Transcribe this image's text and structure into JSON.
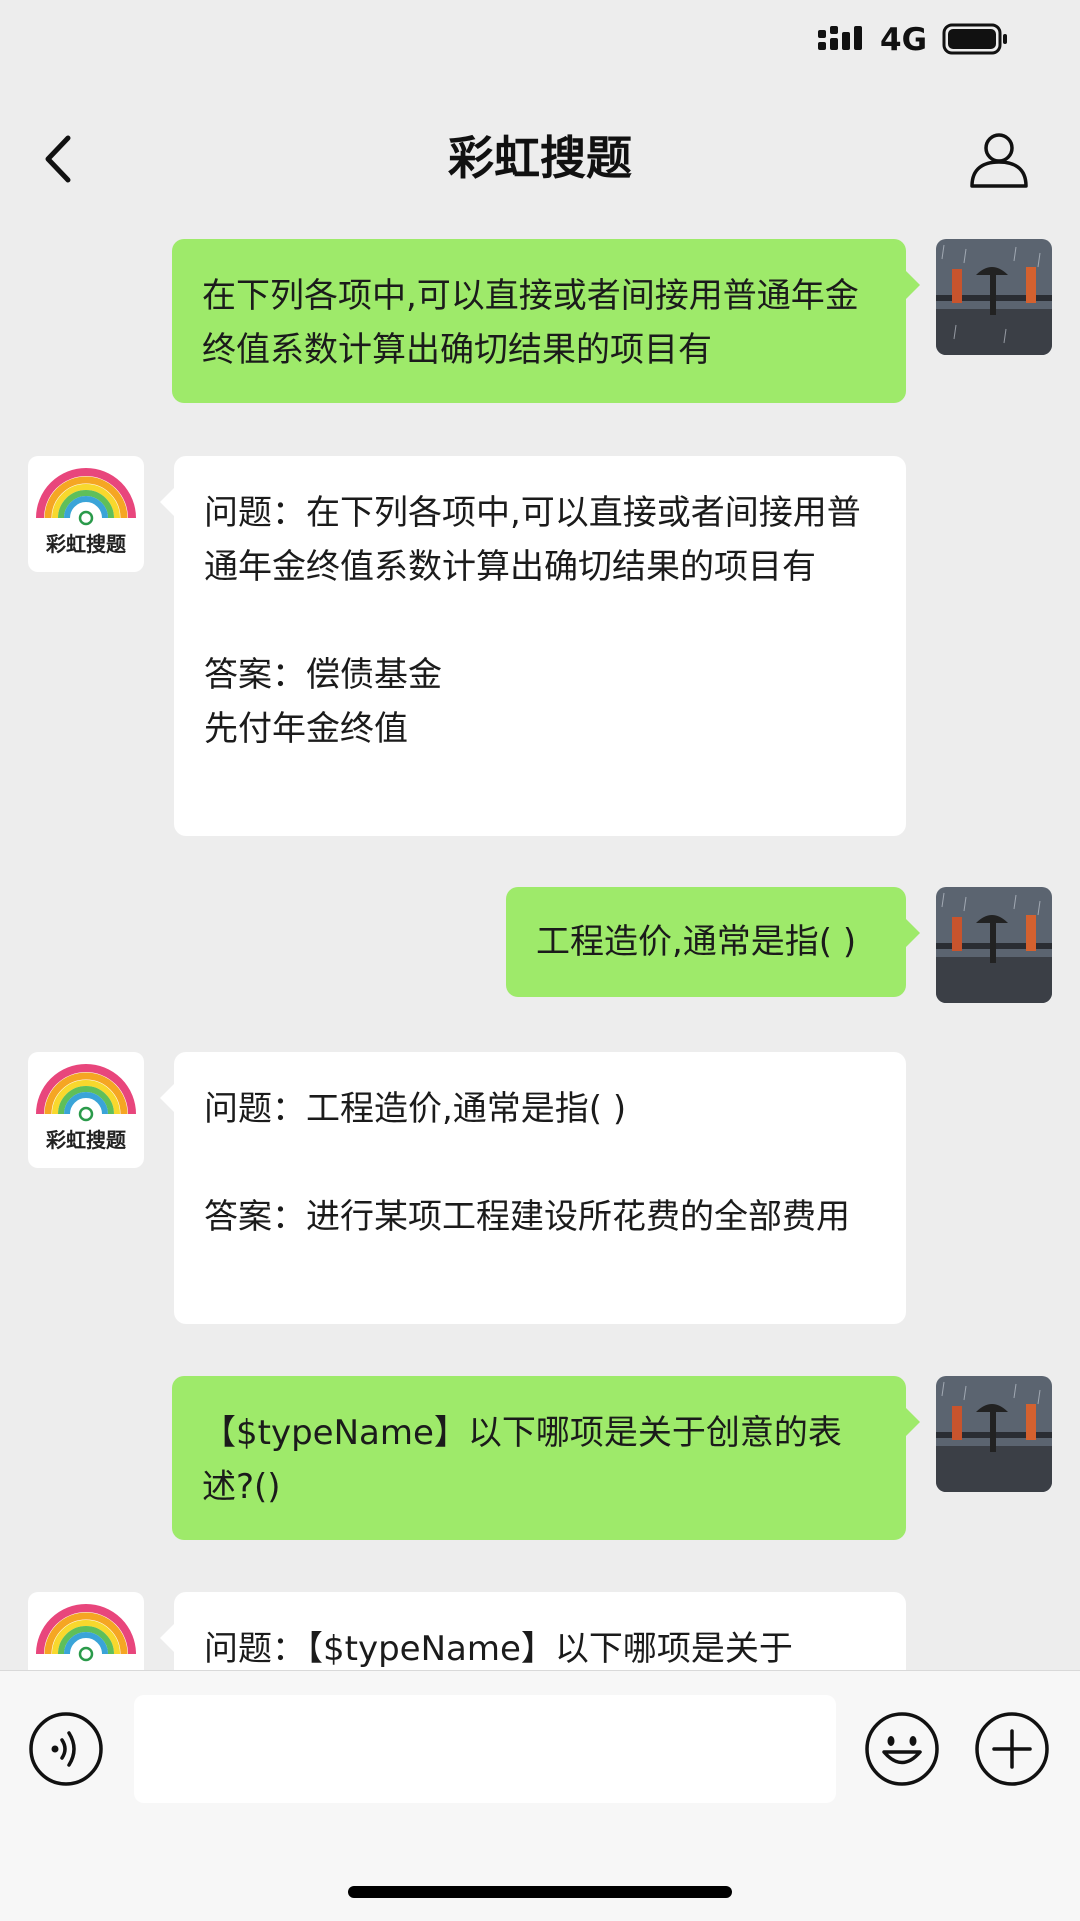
{
  "status_bar": {
    "network": "4G"
  },
  "header": {
    "title": "彩虹搜题"
  },
  "bot": {
    "name": "彩虹搜题"
  },
  "messages": [
    {
      "from": "user",
      "text": "在下列各项中,可以直接或者间接用普通年金终值系数计算出确切结果的项目有"
    },
    {
      "from": "bot",
      "text": "问题：在下列各项中,可以直接或者间接用普通年金终值系数计算出确切结果的项目有\n\n答案：偿债基金\n先付年金终值"
    },
    {
      "from": "user",
      "text": "工程造价,通常是指( )"
    },
    {
      "from": "bot",
      "text": "问题：工程造价,通常是指( )\n\n答案：进行某项工程建设所花费的全部费用"
    },
    {
      "from": "user",
      "text": "【$typeName】以下哪项是关于创意的表述?()"
    },
    {
      "from": "bot",
      "text": "问题：【$typeName】以下哪项是关于"
    }
  ],
  "icons": {
    "back": "chevron-left-icon",
    "profile": "person-icon",
    "voice": "voice-icon",
    "emoji": "emoji-icon",
    "plus": "plus-icon"
  },
  "colors": {
    "outgoing_bubble": "#9eea6a",
    "incoming_bubble": "#ffffff",
    "background": "#ededed"
  }
}
